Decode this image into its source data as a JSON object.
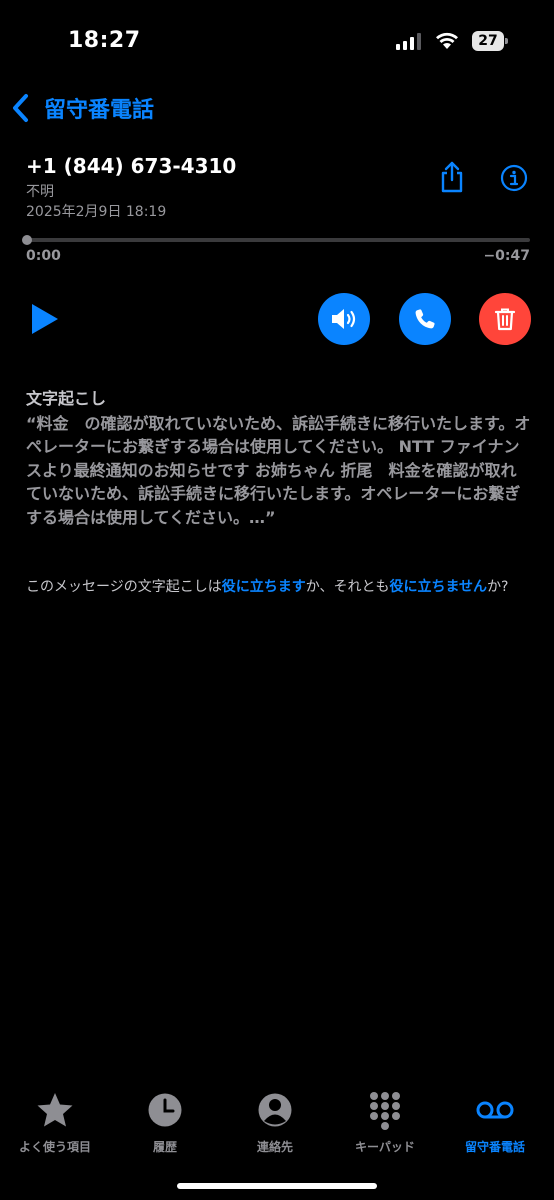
{
  "status": {
    "time": "18:27",
    "battery": "27"
  },
  "nav": {
    "back_label": "留守番電話"
  },
  "voicemail": {
    "phone": "+1 (844) 673-4310",
    "caller_label": "不明",
    "datetime": "2025年2月9日 18:19",
    "elapsed": "0:00",
    "remaining": "−0:47",
    "progress": 0
  },
  "transcription": {
    "title": "文字起こし",
    "text": "“料金　の確認が取れていないため、訴訟手続きに移行いたします。オペレーターにお繋ぎする場合は使用してください。 NTT ファイナンスより最終通知のお知らせです お姉ちゃん 折尾　料金を確認が取れていないため、訴訟手続きに移行いたします。オペレーターにお繋ぎする場合は使用してください。…”"
  },
  "feedback": {
    "prefix": "このメッセージの文字起こしは",
    "useful": "役に立ちます",
    "middle": "か、それとも",
    "not_useful": "役に立ちません",
    "suffix": "か?"
  },
  "tabs": [
    {
      "label": "よく使う項目",
      "icon": "star-icon"
    },
    {
      "label": "履歴",
      "icon": "clock-icon"
    },
    {
      "label": "連絡先",
      "icon": "person-icon"
    },
    {
      "label": "キーパッド",
      "icon": "keypad-icon"
    },
    {
      "label": "留守番電話",
      "icon": "voicemail-icon"
    }
  ],
  "colors": {
    "accent": "#0a84ff",
    "delete": "#ff453a",
    "secondary_text": "#98989d"
  }
}
